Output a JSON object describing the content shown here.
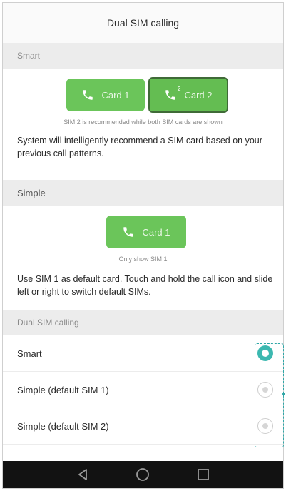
{
  "title": "Dual SIM calling",
  "smart_section": {
    "header": "Smart",
    "card1_label": "Card 1",
    "card2_label": "Card 2",
    "card2_badge": "2",
    "caption": "SIM 2 is recommended while both SIM cards are shown",
    "description": "System will intelligently recommend a SIM card based on your previous call patterns."
  },
  "simple_section": {
    "header": "Simple",
    "card1_label": "Card 1",
    "caption": "Only show SIM 1",
    "description": "Use SIM 1 as default card. Touch and hold the call icon and slide left or right to switch default SIMs."
  },
  "options_section": {
    "header": "Dual SIM calling",
    "options": [
      {
        "label": "Smart",
        "selected": true
      },
      {
        "label": "Simple (default SIM 1)",
        "selected": false
      },
      {
        "label": "Simple (default SIM 2)",
        "selected": false
      }
    ]
  },
  "navbar": {
    "icons": [
      "back-icon",
      "home-icon",
      "recents-icon"
    ]
  },
  "colors": {
    "card_green": "#6bc55a",
    "radio_accent": "#3cb8b0",
    "highlight": "#2fa7a7"
  }
}
